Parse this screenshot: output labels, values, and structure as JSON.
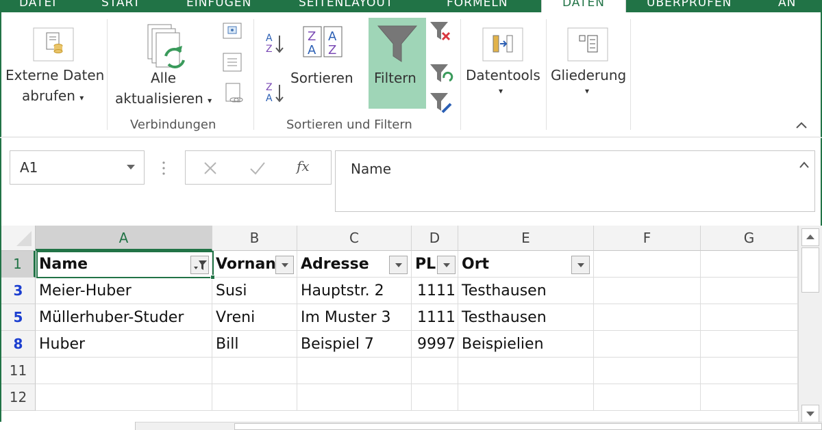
{
  "tabs": [
    {
      "label": "DATEI",
      "active": false
    },
    {
      "label": "START",
      "active": false
    },
    {
      "label": "EINFÜGEN",
      "active": false
    },
    {
      "label": "SEITENLAYOUT",
      "active": false
    },
    {
      "label": "FORMELN",
      "active": false
    },
    {
      "label": "DATEN",
      "active": true
    },
    {
      "label": "ÜBERPRÜFEN",
      "active": false
    },
    {
      "label": "AN",
      "active": false
    }
  ],
  "ribbon": {
    "externe_line1": "Externe Daten",
    "externe_line2": "abrufen",
    "alle_line1": "Alle",
    "alle_line2": "aktualisieren",
    "sortieren": "Sortieren",
    "filtern": "Filtern",
    "datentools": "Datentools",
    "gliederung": "Gliederung",
    "group_verbindungen": "Verbindungen",
    "group_sortieren_filtern": "Sortieren und Filtern"
  },
  "formula_bar": {
    "name_box": "A1",
    "fx": "fx",
    "formula_value": "Name"
  },
  "columns": [
    "A",
    "B",
    "C",
    "D",
    "E",
    "F",
    "G"
  ],
  "header_row": {
    "row_number": "1",
    "cells": [
      "Name",
      "Vornan",
      "Adresse",
      "PL",
      "Ort",
      "",
      ""
    ]
  },
  "rows": [
    {
      "row_number": "3",
      "filtered": true,
      "cells": [
        "Meier-Huber",
        "Susi",
        "Hauptstr. 2",
        "1111",
        "Testhausen",
        "",
        ""
      ]
    },
    {
      "row_number": "5",
      "filtered": true,
      "cells": [
        "Müllerhuber-Studer",
        "Vreni",
        "Im Muster 3",
        "1111",
        "Testhausen",
        "",
        ""
      ]
    },
    {
      "row_number": "8",
      "filtered": true,
      "cells": [
        "Huber",
        "Bill",
        "Beispiel 7",
        "9997",
        "Beispielien",
        "",
        ""
      ]
    },
    {
      "row_number": "11",
      "filtered": false,
      "cells": [
        "",
        "",
        "",
        "",
        "",
        "",
        ""
      ]
    },
    {
      "row_number": "12",
      "filtered": false,
      "cells": [
        "",
        "",
        "",
        "",
        "",
        "",
        ""
      ]
    }
  ],
  "colors": {
    "accent": "#217346",
    "filter_active_bg": "#9fd5b7",
    "filtered_row_number": "#1c3fd0"
  }
}
